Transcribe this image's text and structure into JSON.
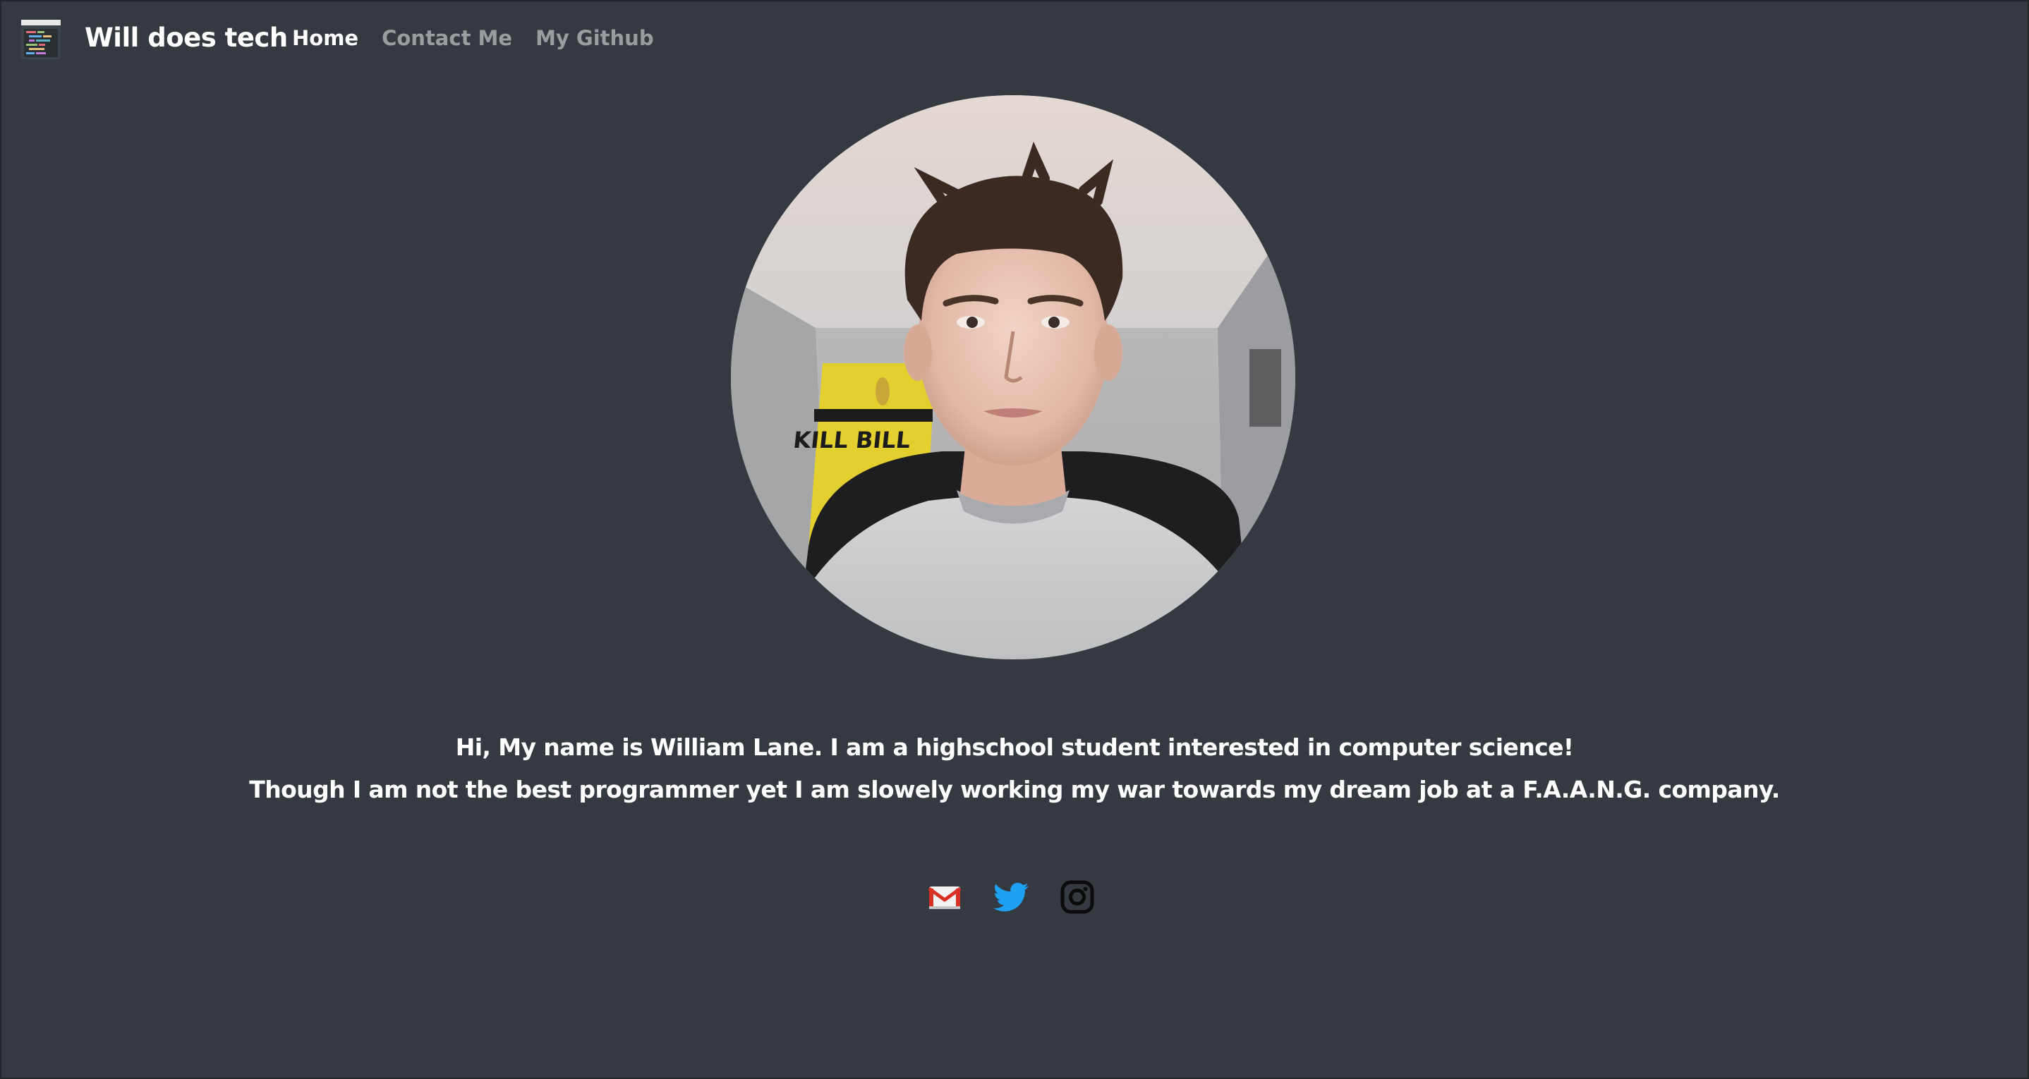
{
  "navbar": {
    "logo_icon": "code-editor-logo-icon",
    "brand": "Will does tech",
    "links": [
      {
        "label": "Home",
        "active": true
      },
      {
        "label": "Contact Me",
        "active": false
      },
      {
        "label": "My Github",
        "active": false
      }
    ]
  },
  "profile": {
    "photo_icon": "profile-photo"
  },
  "bio": {
    "line1": "Hi, My name is William Lane. I am a highschool student interested in computer science!",
    "line2": "Though I am not the best programmer yet I am slowely working my war towards my dream job at a F.A.A.N.G. company."
  },
  "social": [
    {
      "icon": "gmail-icon"
    },
    {
      "icon": "twitter-icon"
    },
    {
      "icon": "instagram-icon"
    }
  ],
  "colors": {
    "background": "#343a40",
    "nav_active": "#ffffff",
    "nav_inactive": "rgba(255,255,255,0.5)",
    "twitter_blue": "#1da1f2",
    "gmail_red": "#d93025"
  }
}
